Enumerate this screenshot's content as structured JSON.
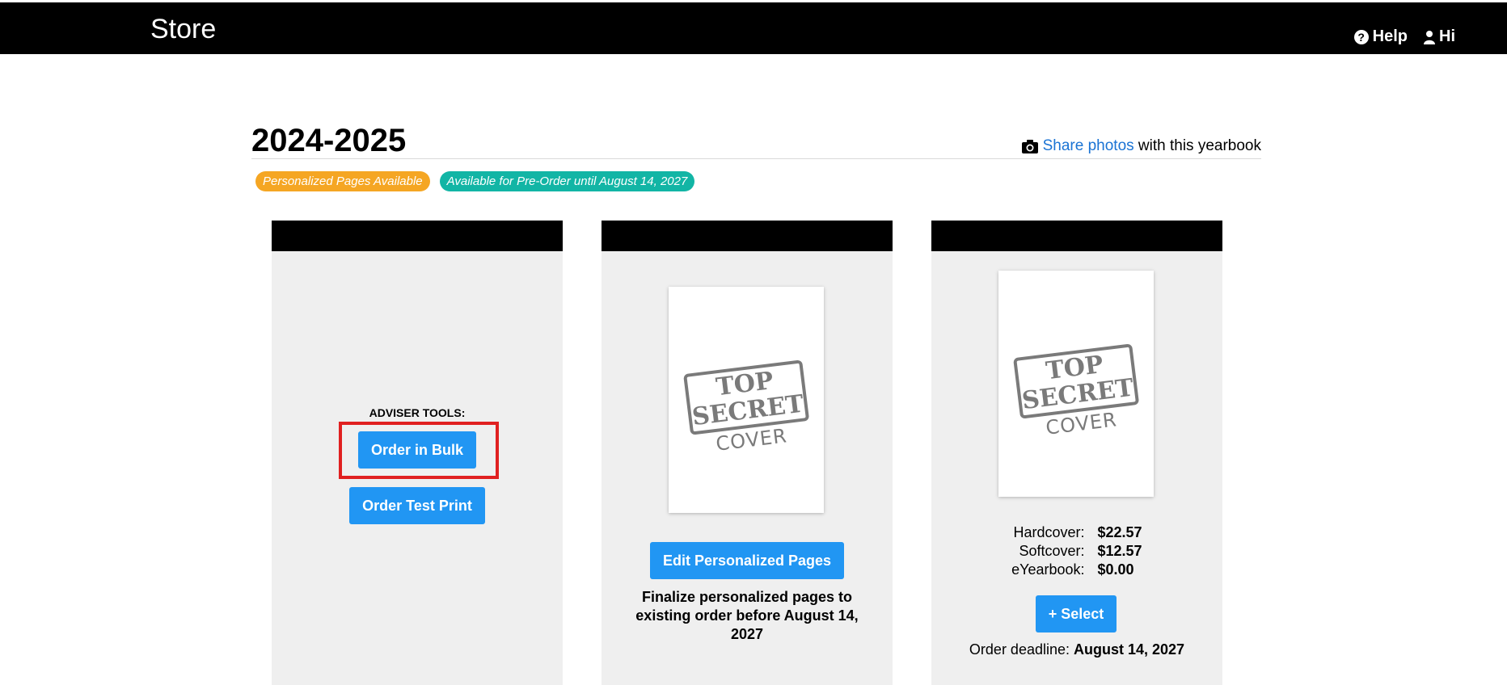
{
  "header": {
    "title": "Store",
    "help_label": "Help",
    "user_label": "Hi"
  },
  "yearbook": {
    "title": "2024-2025",
    "share_link": "Share photos",
    "share_suffix": " with this yearbook",
    "badges": [
      "Personalized Pages Available",
      "Available for Pre-Order until August 14, 2027"
    ],
    "badge_colors": [
      "#f5a623",
      "#12b5a5"
    ]
  },
  "card1": {
    "label": "ADVISER TOOLS:",
    "order_bulk": "Order in Bulk",
    "order_test_print": "Order Test Print"
  },
  "card2": {
    "cover_stamp": [
      "TOP",
      "SECRET",
      "COVER"
    ],
    "edit_button": "Edit Personalized Pages",
    "finalize_text": "Finalize personalized pages to existing order before August 14, 2027"
  },
  "card3": {
    "cover_stamp": [
      "TOP",
      "SECRET",
      "COVER"
    ],
    "prices": [
      {
        "label": "Hardcover:",
        "value": "$22.57"
      },
      {
        "label": "Softcover:",
        "value": "$12.57"
      },
      {
        "label": "eYearbook:",
        "value": "$0.00"
      }
    ],
    "select_button": "+ Select",
    "deadline_label": "Order deadline:",
    "deadline_value": "August 14, 2027"
  },
  "colors": {
    "accent_button": "#2196f3",
    "link": "#1a73d4",
    "highlight": "#e02020",
    "card_bg": "#efefef"
  }
}
